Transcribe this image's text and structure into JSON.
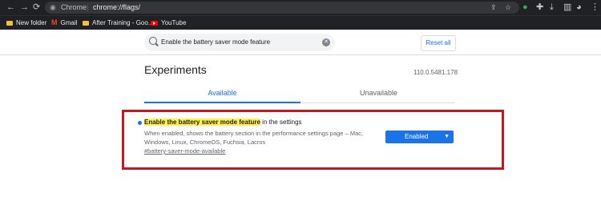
{
  "browser": {
    "omnibox_site": "Chrome",
    "omnibox_url": "chrome://flags/",
    "bookmarks": [
      {
        "label": "New folder"
      },
      {
        "label": "Gmail"
      },
      {
        "label": "After Training - Goo..."
      },
      {
        "label": "YouTube"
      }
    ]
  },
  "search": {
    "value": "Enable the battery saver mode feature"
  },
  "reset_label": "Reset all",
  "page_title": "Experiments",
  "version": "110.0.5481.178",
  "tabs": [
    {
      "label": "Available",
      "active": true
    },
    {
      "label": "Unavailable",
      "active": false
    }
  ],
  "experiment": {
    "name_highlight": "Enable the battery saver mode feature",
    "name_rest": " in the settings",
    "description": "When enabled, shows the battery section in the performance settings page – Mac, Windows, Linux, ChromeOS, Fuchsia, Lacros",
    "link": "#battery-saver-mode-available",
    "select_value": "Enabled"
  },
  "colors": {
    "accent": "#1a73e8",
    "highlight": "#fff04a",
    "annotation_box": "#c5191e"
  }
}
